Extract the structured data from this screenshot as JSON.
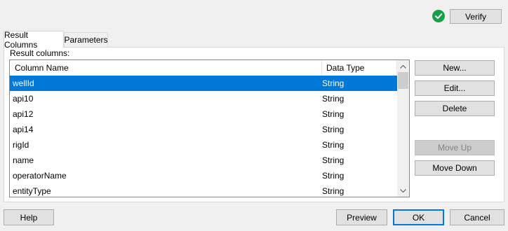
{
  "header": {
    "verify_label": "Verify",
    "verify_status_icon": "check-circle-icon"
  },
  "tabs": [
    {
      "label": "Result Columns",
      "active": true
    },
    {
      "label": "Parameters",
      "active": false
    }
  ],
  "result_columns": {
    "section_label": "Result columns:",
    "columns": [
      "Column Name",
      "Data Type"
    ],
    "rows": [
      {
        "name": "wellId",
        "type": "String",
        "selected": true
      },
      {
        "name": "api10",
        "type": "String"
      },
      {
        "name": "api12",
        "type": "String"
      },
      {
        "name": "api14",
        "type": "String"
      },
      {
        "name": "rigId",
        "type": "String"
      },
      {
        "name": "name",
        "type": "String"
      },
      {
        "name": "operatorName",
        "type": "String"
      },
      {
        "name": "entityType",
        "type": "String"
      }
    ]
  },
  "side_buttons": {
    "new_label": "New...",
    "edit_label": "Edit...",
    "delete_label": "Delete",
    "move_up_label": "Move Up",
    "move_down_label": "Move Down"
  },
  "footer": {
    "help_label": "Help",
    "preview_label": "Preview",
    "ok_label": "OK",
    "cancel_label": "Cancel"
  },
  "colors": {
    "selection": "#0078d7",
    "verify_ok": "#16a04a"
  }
}
